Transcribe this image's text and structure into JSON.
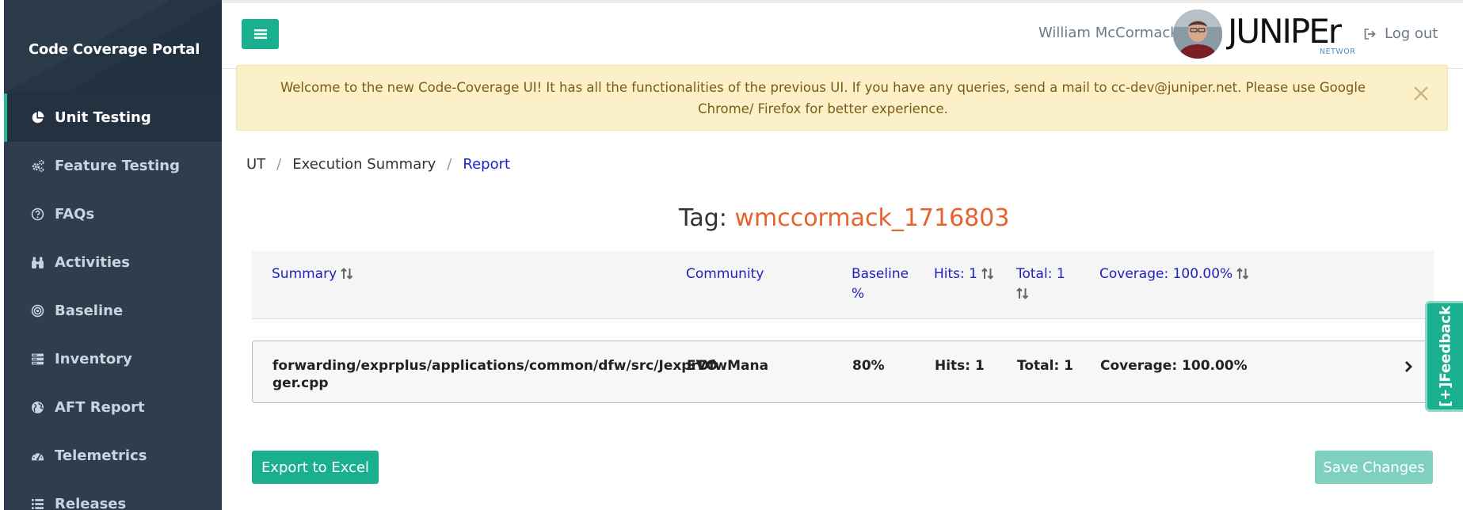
{
  "app": {
    "title": "Code Coverage Portal"
  },
  "sidebar": {
    "items": [
      {
        "label": "Unit Testing",
        "icon": "pie-chart-icon"
      },
      {
        "label": "Feature Testing",
        "icon": "gears-icon"
      },
      {
        "label": "FAQs",
        "icon": "question-circle-icon"
      },
      {
        "label": "Activities",
        "icon": "binoculars-icon"
      },
      {
        "label": "Baseline",
        "icon": "bullseye-icon"
      },
      {
        "label": "Inventory",
        "icon": "server-icon"
      },
      {
        "label": "AFT Report",
        "icon": "globe-icon"
      },
      {
        "label": "Telemetrics",
        "icon": "dashboard-icon"
      },
      {
        "label": "Releases",
        "icon": "list-icon"
      }
    ],
    "active_index": 0
  },
  "header": {
    "user_name": "William McCormack",
    "logo_text": "JUNIPEr",
    "logo_sub": "NETWORKS",
    "logout_label": "Log out"
  },
  "alert": {
    "message": "Welcome to the new Code-Coverage UI! It has all the functionalities of the previous UI. If you have any queries, send a mail to cc-dev@juniper.net. Please use Google Chrome/ Firefox for better experience."
  },
  "breadcrumb": {
    "items": [
      "UT",
      "Execution Summary",
      "Report"
    ],
    "separator": "/"
  },
  "tag": {
    "label": "Tag:",
    "value": "wmccormack_1716803"
  },
  "table": {
    "headers": {
      "summary": "Summary",
      "community": "Community",
      "baseline_line1": "Baseline",
      "baseline_line2": "%",
      "hits": "Hits: 1",
      "total": "Total: 1",
      "coverage": "Coverage: 100.00%"
    },
    "rows": [
      {
        "summary_line1": "forwarding/exprplus/applications/common/dfw/src/JexprDfwMana",
        "summary_line2": "ger.cpp",
        "community": "EVO",
        "baseline": "80%",
        "hits": "Hits: 1",
        "total": "Total: 1",
        "coverage": "Coverage: 100.00%"
      }
    ]
  },
  "buttons": {
    "export": "Export to Excel",
    "save": "Save Changes"
  },
  "feedback": {
    "label": "[+]Feedback"
  },
  "colors": {
    "sidebar_bg": "#2e3e4e",
    "accent": "#1aaf8f",
    "link": "#1f1fbf",
    "tag": "#e8622c",
    "alert_bg": "#fcf0c8"
  }
}
